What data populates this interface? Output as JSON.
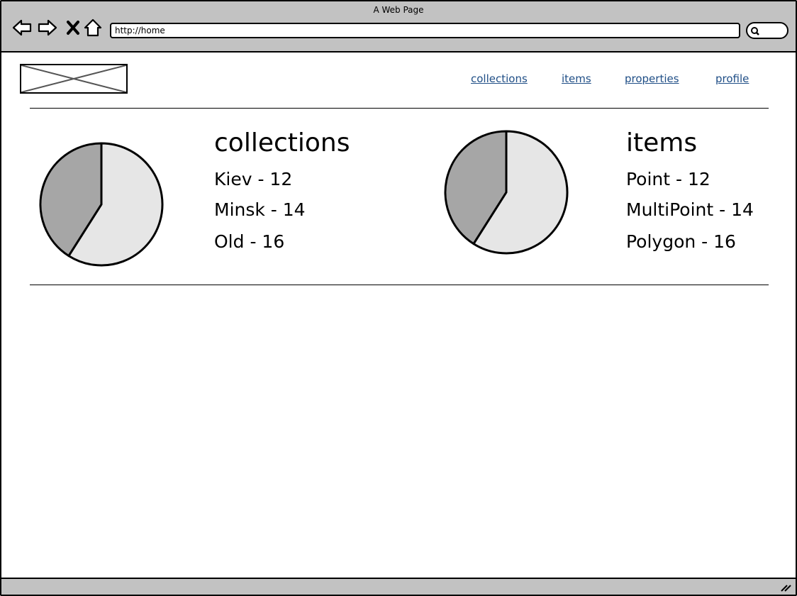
{
  "window": {
    "title": "A Web Page"
  },
  "browser": {
    "url": "http://home",
    "icons": [
      "back-arrow-icon",
      "forward-arrow-icon",
      "stop-x-icon",
      "home-icon",
      "search-icon"
    ]
  },
  "nav": {
    "links": [
      "collections",
      "items",
      "properties",
      "profile"
    ]
  },
  "panels": [
    {
      "title": "collections",
      "items": [
        "Kiev - 12",
        "Minsk - 14",
        "Old - 16"
      ]
    },
    {
      "title": "items",
      "items": [
        "Point - 12",
        "MultiPoint - 14",
        "Polygon - 16"
      ]
    }
  ],
  "chart_data": [
    {
      "type": "pie",
      "slices": [
        {
          "label": "light",
          "fraction": 0.59,
          "color": "#e6e6e6"
        },
        {
          "label": "dark",
          "fraction": 0.41,
          "color": "#a6a6a6"
        }
      ]
    },
    {
      "type": "pie",
      "slices": [
        {
          "label": "light",
          "fraction": 0.59,
          "color": "#e6e6e6"
        },
        {
          "label": "dark",
          "fraction": 0.41,
          "color": "#a6a6a6"
        }
      ]
    }
  ],
  "colors": {
    "chrome": "#c2c2c2",
    "link": "#1f4e86"
  }
}
